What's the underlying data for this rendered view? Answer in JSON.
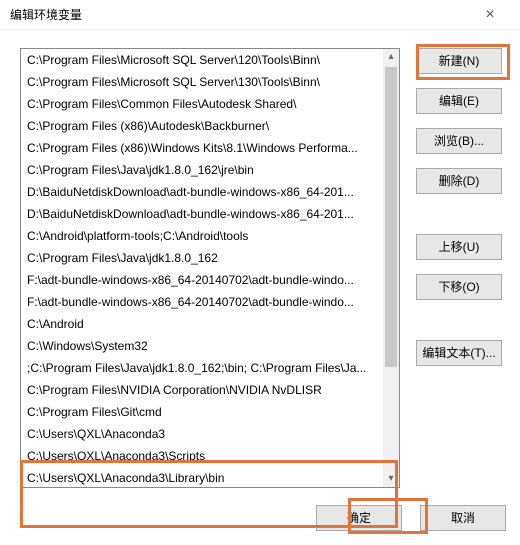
{
  "window": {
    "title": "编辑环境变量"
  },
  "list": {
    "items": [
      "C:\\Program Files\\Microsoft SQL Server\\120\\Tools\\Binn\\",
      "C:\\Program Files\\Microsoft SQL Server\\130\\Tools\\Binn\\",
      "C:\\Program Files\\Common Files\\Autodesk Shared\\",
      "C:\\Program Files (x86)\\Autodesk\\Backburner\\",
      "C:\\Program Files (x86)\\Windows Kits\\8.1\\Windows Performa...",
      "C:\\Program Files\\Java\\jdk1.8.0_162\\jre\\bin",
      "D:\\BaiduNetdiskDownload\\adt-bundle-windows-x86_64-201...",
      "D:\\BaiduNetdiskDownload\\adt-bundle-windows-x86_64-201...",
      "C:\\Android\\platform-tools;C:\\Android\\tools",
      "C:\\Program Files\\Java\\jdk1.8.0_162",
      "F:\\adt-bundle-windows-x86_64-20140702\\adt-bundle-windo...",
      "F:\\adt-bundle-windows-x86_64-20140702\\adt-bundle-windo...",
      "C:\\Android",
      "C:\\Windows\\System32",
      ";C:\\Program Files\\Java\\jdk1.8.0_162;\\bin; C:\\Program Files\\Ja...",
      "C:\\Program Files\\NVIDIA Corporation\\NVIDIA NvDLISR",
      "C:\\Program Files\\Git\\cmd",
      "C:\\Users\\QXL\\Anaconda3",
      "C:\\Users\\QXL\\Anaconda3\\Scripts",
      "C:\\Users\\QXL\\Anaconda3\\Library\\bin"
    ]
  },
  "buttons": {
    "new": "新建(N)",
    "edit": "编辑(E)",
    "browse": "浏览(B)...",
    "delete": "删除(D)",
    "moveup": "上移(U)",
    "movedown": "下移(O)",
    "edittext": "编辑文本(T)...",
    "ok": "确定",
    "cancel": "取消"
  },
  "highlight_color": "#e2733b"
}
